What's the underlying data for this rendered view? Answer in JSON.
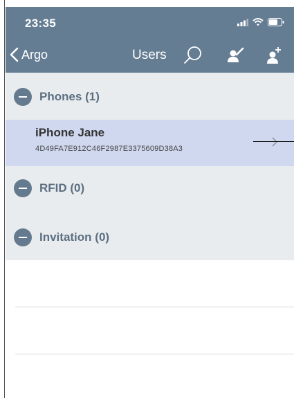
{
  "status_bar": {
    "time": "23:35"
  },
  "nav": {
    "back_label": "Argo",
    "title": "Users"
  },
  "sections": [
    {
      "label": "Phones (1)"
    },
    {
      "label": "RFID (0)"
    },
    {
      "label": "Invitation (0)"
    }
  ],
  "phones": [
    {
      "name": "iPhone Jane",
      "id": "4D49FA7E912C46F2987E3375609D38A3"
    }
  ],
  "colors": {
    "header_bg": "#657d93",
    "list_bg": "#e9ecee",
    "selected_row_bg": "#d0d8ef",
    "section_icon": "#647a8e",
    "section_text": "#5c6f82"
  },
  "icons": [
    "signal-icon",
    "wifi-icon",
    "battery-icon",
    "back-chevron-icon",
    "search-icon",
    "edit-user-icon",
    "add-user-icon",
    "minus-circle-icon",
    "chevron-right-icon"
  ]
}
